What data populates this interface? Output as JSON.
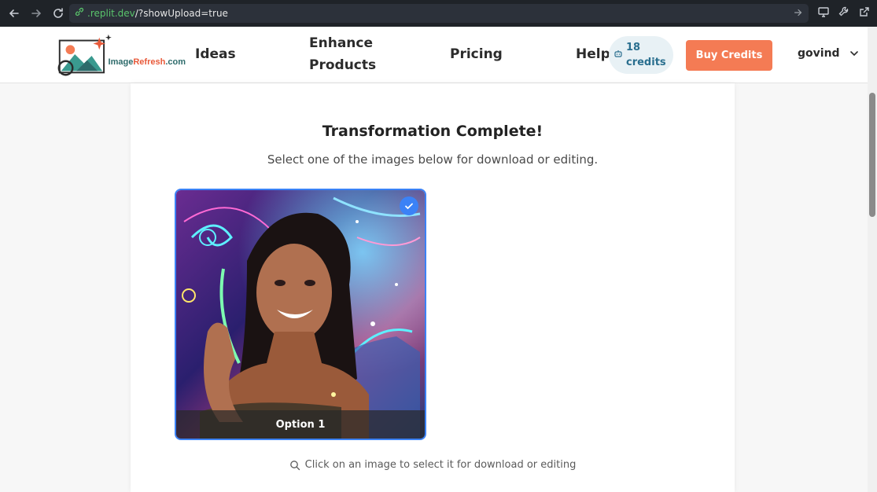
{
  "browser": {
    "url_domain": ".replit.dev",
    "url_path": "/?showUpload=true"
  },
  "header": {
    "logo_text_part1": "Image",
    "logo_text_part2": "Refresh",
    "logo_text_part3": ".com",
    "nav": {
      "ideas": "Ideas",
      "enhance_line1": "Enhance",
      "enhance_line2": "Products",
      "pricing": "Pricing",
      "help": "Help"
    },
    "credits_count": "18",
    "credits_label": "credits",
    "buy_credits": "Buy Credits",
    "username": "govind"
  },
  "main": {
    "title": "Transformation Complete!",
    "subtitle": "Select one of the images below for download or editing.",
    "options": [
      {
        "label": "Option 1",
        "selected": true
      }
    ],
    "hint": "Click on an image to select it for download or editing"
  },
  "colors": {
    "accent": "#3b82f6",
    "buy_button": "#f47b54",
    "url_domain": "#59c46b"
  },
  "icons": {
    "back": "arrow-left-icon",
    "forward": "arrow-right-icon",
    "reload": "reload-icon",
    "link": "link-icon",
    "go": "arrow-right-icon",
    "devices": "monitor-icon",
    "tools": "wrench-icon",
    "external": "external-link-icon",
    "credits": "robot-icon",
    "dropdown": "chevron-down-icon",
    "check": "check-icon",
    "search": "search-icon"
  }
}
